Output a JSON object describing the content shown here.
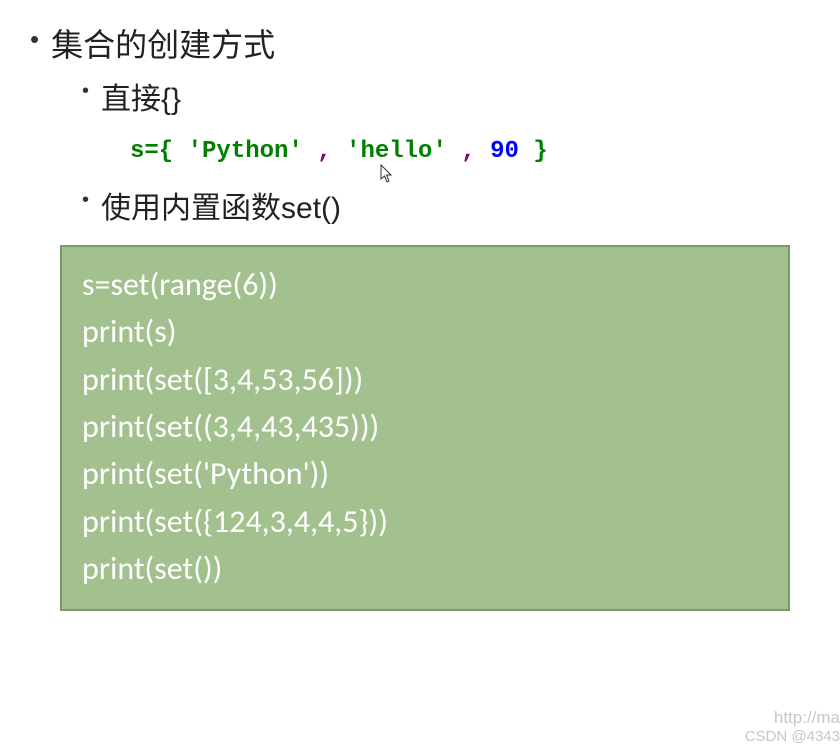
{
  "bullets": {
    "l1": "集合的创建方式",
    "l2a": "直接{}",
    "l2b": "使用内置函数set()"
  },
  "inline_code": {
    "seg1": "s={ ",
    "seg2": "'Python'",
    "seg3": " , ",
    "seg4": "'hello'",
    "seg5": "   ,",
    "seg6": " 90",
    "seg7": "   }"
  },
  "code_block": {
    "l1": "s=set(range(6))",
    "l2": "print(s)",
    "l3": "print(set([3,4,53,56]))",
    "l4": "print(set((3,4,43,435)))",
    "l5": "print(set('Python'))",
    "l6": "print(set({124,3,4,4,5}))",
    "l7": "print(set())"
  },
  "watermark": {
    "line1": "http://ma",
    "line2": "CSDN @4343"
  }
}
